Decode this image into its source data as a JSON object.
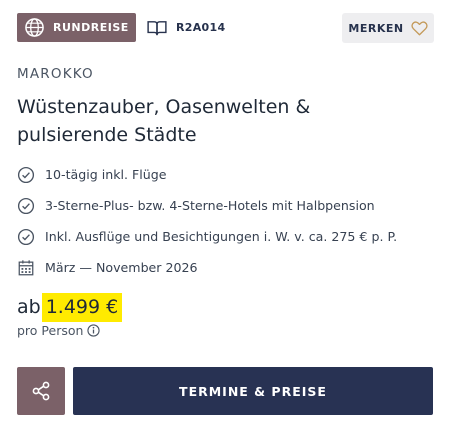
{
  "badges": {
    "type_label": "RUNDREISE",
    "code": "R2A014",
    "merken_label": "MERKEN"
  },
  "offer": {
    "country": "MAROKKO",
    "title": "Wüstenzauber, Oasenwelten & pulsierende Städte",
    "features": [
      {
        "icon": "check-circle-icon",
        "text": "10-tägig inkl. Flüge"
      },
      {
        "icon": "check-circle-icon",
        "text": "3-Sterne-Plus- bzw. 4-Sterne-Hotels mit Halbpension"
      },
      {
        "icon": "check-circle-icon",
        "text": "Inkl. Ausflüge und Besichtigungen i. W. v. ca. 275 € p. P."
      },
      {
        "icon": "calendar-icon",
        "text": "März — November 2026"
      }
    ]
  },
  "price": {
    "prefix": "ab",
    "amount": "1.499 €",
    "per_person": "pro Person"
  },
  "actions": {
    "cta_label": "TERMINE & PREISE"
  },
  "colors": {
    "badge": "#7b6168",
    "navy": "#283253",
    "highlight": "#ffeb00",
    "heart": "#c49a5a"
  }
}
